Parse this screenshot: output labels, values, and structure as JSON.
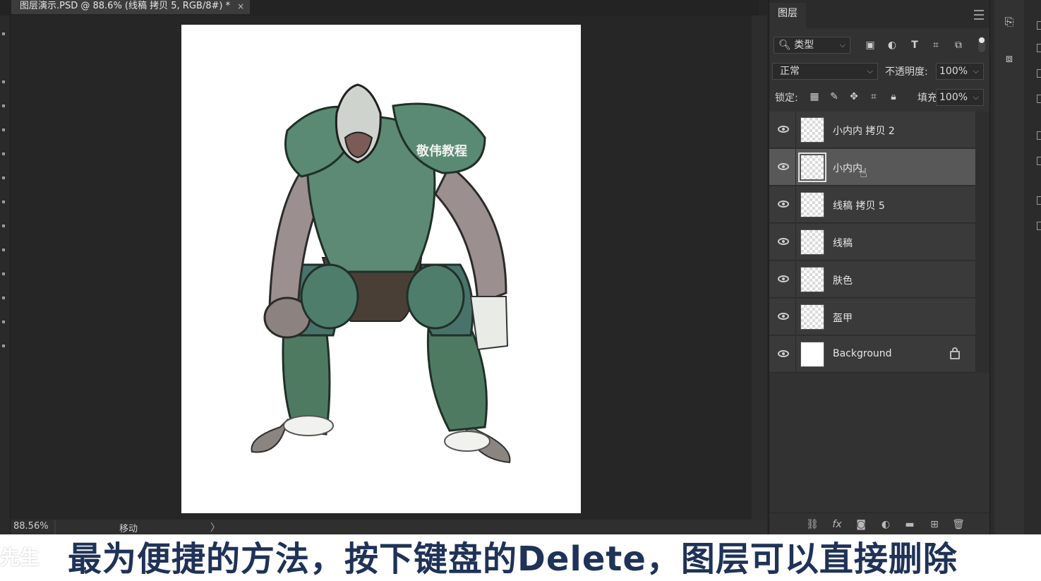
{
  "document": {
    "tab_title": "图层演示.PSD @ 88.6% (线稿 拷贝 5, RGB/8#) *",
    "tab_close": "×"
  },
  "status_bar": {
    "zoom": "88.56%",
    "tool": "移动",
    "arrow": "〉"
  },
  "canvas": {
    "watermark": "敬伟教程",
    "paper_color": "#ffffff"
  },
  "layers_panel": {
    "tab_label": "图层",
    "filter": {
      "label": "类型",
      "chevron": "⌵"
    },
    "blend_mode": "正常",
    "opacity_label": "不透明度:",
    "opacity_value": "100%",
    "lock_label": "锁定:",
    "fill_label": "填充:",
    "fill_value": "100%",
    "layers": [
      {
        "name": "小内内 拷贝 2",
        "selected": false
      },
      {
        "name": "小内内",
        "selected": true
      },
      {
        "name": "线稿 拷贝 5",
        "selected": false
      },
      {
        "name": "线稿",
        "selected": false
      },
      {
        "name": "肤色",
        "selected": false
      },
      {
        "name": "盔甲",
        "selected": false
      },
      {
        "name": "Background",
        "selected": false,
        "locked": true
      }
    ],
    "footer_icons": [
      "link-icon",
      "fx-icon",
      "mask-icon",
      "adjustment-icon",
      "folder-icon",
      "new-layer-icon",
      "trash-icon"
    ]
  },
  "subtitle": {
    "text": "最为便捷的方法，按下键盘的Delete，图层可以直接删除",
    "watermark": "先生"
  },
  "colors": {
    "ui_dark": "#262626",
    "panel": "#323232",
    "selected_layer": "#585858",
    "subtitle_text": "#1f3257"
  }
}
